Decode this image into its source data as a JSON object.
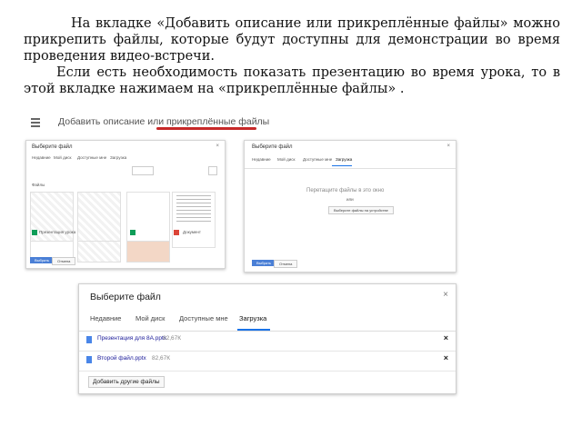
{
  "text": {
    "p1": "На вкладке «Добавить описание или прикреплённые файлы» можно прикрепить файлы, которые будут доступны для демонстрации во время проведения видео-встречи.",
    "p2": "Если есть необходимость показать презентацию во время урока, то в этой вкладке нажимаем на «прикреплённые файлы» ."
  },
  "toolbar": {
    "label": "Добавить описание или прикреплённые файлы"
  },
  "shot1": {
    "title": "Выберите файл",
    "close": "×",
    "tabs": [
      "Недавние",
      "Мой диск",
      "Доступные мне",
      "Загрузка"
    ],
    "section": "Файлы",
    "files": [
      "Презентация урока",
      "",
      "",
      "Документ"
    ],
    "buttons": {
      "select": "Выбрать",
      "cancel": "Отмена"
    }
  },
  "shot2": {
    "title": "Выберите файл",
    "close": "×",
    "tabs": [
      "Недавние",
      "Мой диск",
      "Доступные мне",
      "Загрузка"
    ],
    "drop_text": "Перетащите файлы в это окно",
    "or": "или",
    "choose_button": "Выберите файлы на устройстве",
    "buttons": {
      "select": "Выбрать",
      "cancel": "Отмена"
    }
  },
  "dialog": {
    "title": "Выберите файл",
    "close": "×",
    "tabs": [
      "Недавние",
      "Мой диск",
      "Доступные мне",
      "Загрузка"
    ],
    "active_tab": "Загрузка",
    "files": [
      {
        "name": "Презентация для 8А.pptx",
        "size": "82,67К"
      },
      {
        "name": "Второй файл.pptx",
        "size": "82,67К"
      }
    ],
    "remove": "×",
    "add_more": "Добавить другие файлы"
  },
  "colors": {
    "underline": "#c62828",
    "accent": "#1a73e8"
  }
}
